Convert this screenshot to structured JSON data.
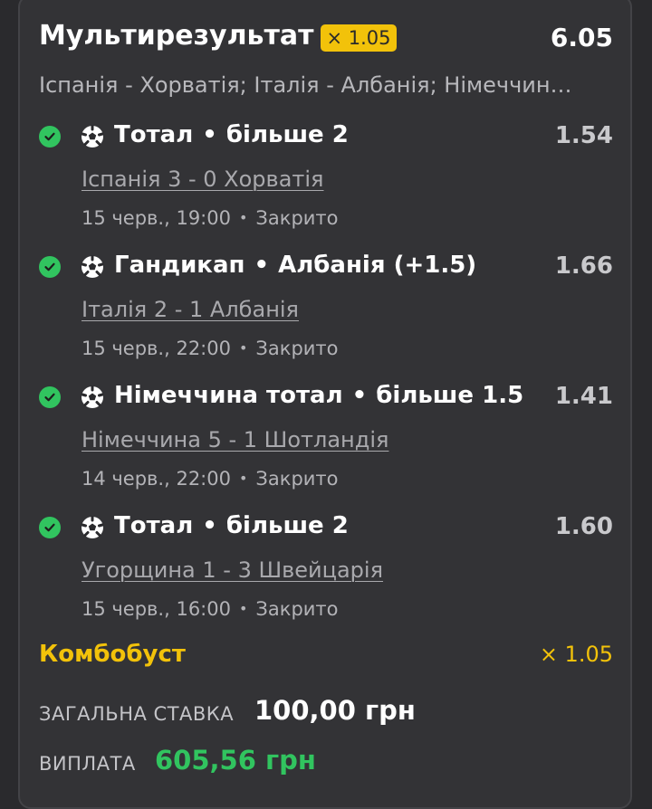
{
  "header": {
    "title": "Мультирезультат",
    "boost_badge": "× 1.05",
    "total_odds": "6.05",
    "events_summary": "Іспанія - Хорватія; Італія - Албанія; Німеччин…"
  },
  "selections": [
    {
      "market": "Тотал",
      "outcome": "більше 2",
      "odds": "1.54",
      "match": "Іспанія 3 - 0 Хорватія",
      "datetime": "15 черв., 19:00",
      "status": "Закрито"
    },
    {
      "market": "Гандикап",
      "outcome": "Албанія (+1.5)",
      "odds": "1.66",
      "match": "Італія 2 - 1 Албанія",
      "datetime": "15 черв., 22:00",
      "status": "Закрито"
    },
    {
      "market": "Німеччина тотал",
      "outcome": "більше 1.5",
      "odds": "1.41",
      "match": "Німеччина 5 - 1 Шотландія",
      "datetime": "14 черв., 22:00",
      "status": "Закрито"
    },
    {
      "market": "Тотал",
      "outcome": "більше 2",
      "odds": "1.60",
      "match": "Угорщина 1 - 3 Швейцарія",
      "datetime": "15 черв., 16:00",
      "status": "Закрито"
    }
  ],
  "separator": "•",
  "combo": {
    "label": "Комбобуст",
    "value": "× 1.05"
  },
  "stake": {
    "label": "ЗАГАЛЬНА СТАВКА",
    "value": "100,00 грн"
  },
  "payout": {
    "label": "ВИПЛАТА",
    "value": "605,56 грн"
  },
  "colors": {
    "accent_yellow": "#f2c20a",
    "win_green": "#31c45f",
    "card_bg": "#333336"
  },
  "icons": {
    "selection_status": "check-circle-icon",
    "sport": "soccer-ball-icon"
  }
}
